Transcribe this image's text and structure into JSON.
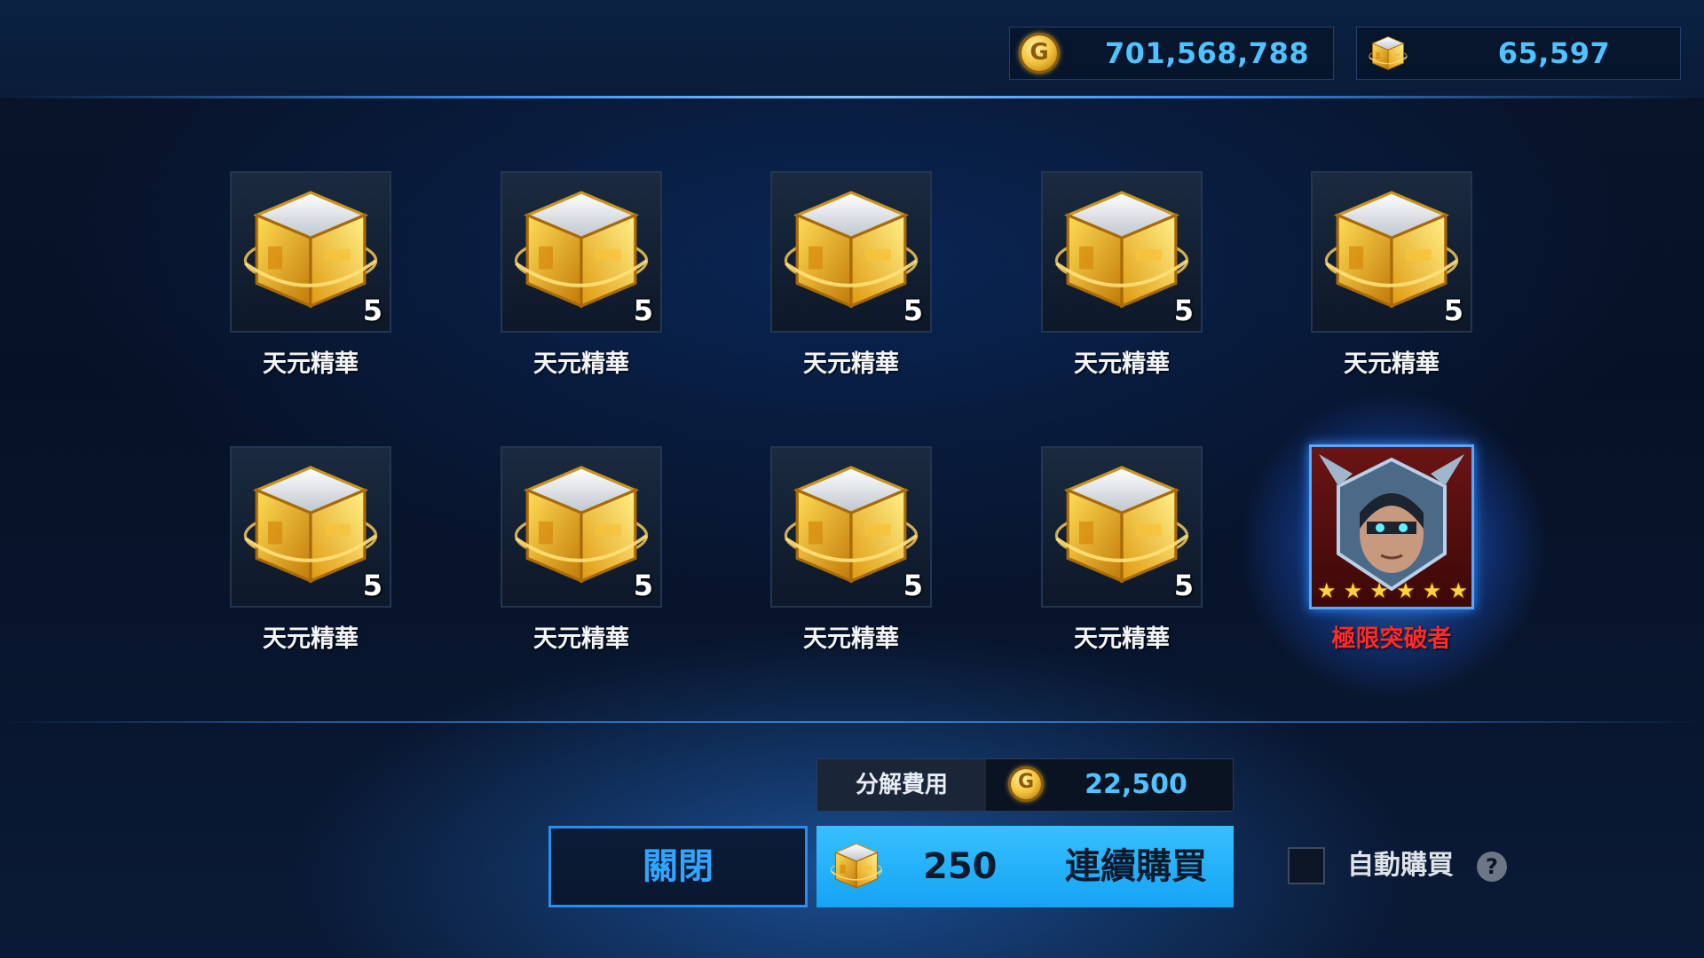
{
  "currencies": {
    "gold": {
      "icon": "gold-coin-icon",
      "amount": "701,568,788",
      "coin_glyph": "G"
    },
    "cube": {
      "icon": "essence-cube-icon",
      "amount": "65,597"
    }
  },
  "items": [
    {
      "name": "天元精華",
      "quantity": "5",
      "icon": "essence-cube-icon"
    },
    {
      "name": "天元精華",
      "quantity": "5",
      "icon": "essence-cube-icon"
    },
    {
      "name": "天元精華",
      "quantity": "5",
      "icon": "essence-cube-icon"
    },
    {
      "name": "天元精華",
      "quantity": "5",
      "icon": "essence-cube-icon"
    },
    {
      "name": "天元精華",
      "quantity": "5",
      "icon": "essence-cube-icon"
    },
    {
      "name": "天元精華",
      "quantity": "5",
      "icon": "essence-cube-icon"
    },
    {
      "name": "天元精華",
      "quantity": "5",
      "icon": "essence-cube-icon"
    },
    {
      "name": "天元精華",
      "quantity": "5",
      "icon": "essence-cube-icon"
    },
    {
      "name": "天元精華",
      "quantity": "5",
      "icon": "essence-cube-icon"
    },
    {
      "name": "極限突破者",
      "icon": "hero-portrait-icon",
      "stars": 6,
      "star_glyph": "★",
      "name_color": "#ff2a2a"
    }
  ],
  "decompose_fee": {
    "label": "分解費用",
    "icon": "gold-coin-icon",
    "value": "22,500"
  },
  "buttons": {
    "close": "關閉",
    "continuous_buy": "連續購買",
    "buy_price": "250"
  },
  "auto_buy": {
    "label": "自動購買",
    "checked": false,
    "help": "?"
  },
  "colors": {
    "accent": "#4fc3ff",
    "button": "#1aaaf5",
    "hero_name": "#ff2a2a"
  }
}
